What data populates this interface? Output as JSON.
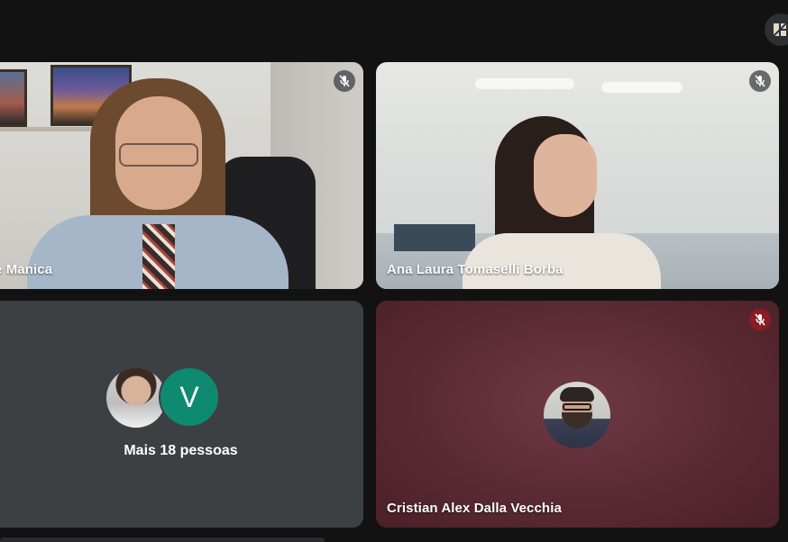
{
  "toolbar": {
    "top_right_icon": "layout-grid-icon"
  },
  "tiles": [
    {
      "name": "e Manica",
      "mic": "muted"
    },
    {
      "name": "Ana Laura Tomaselli Borba",
      "mic": "muted"
    },
    {
      "name": "",
      "group_label": "Mais 18 pessoas",
      "avatar_letter": "V",
      "avatar_color": "#0e8a70"
    },
    {
      "name": "Cristian Alex Dalla Vecchia",
      "mic": "muted-highlighted",
      "background_color": "#5a2a34"
    }
  ]
}
